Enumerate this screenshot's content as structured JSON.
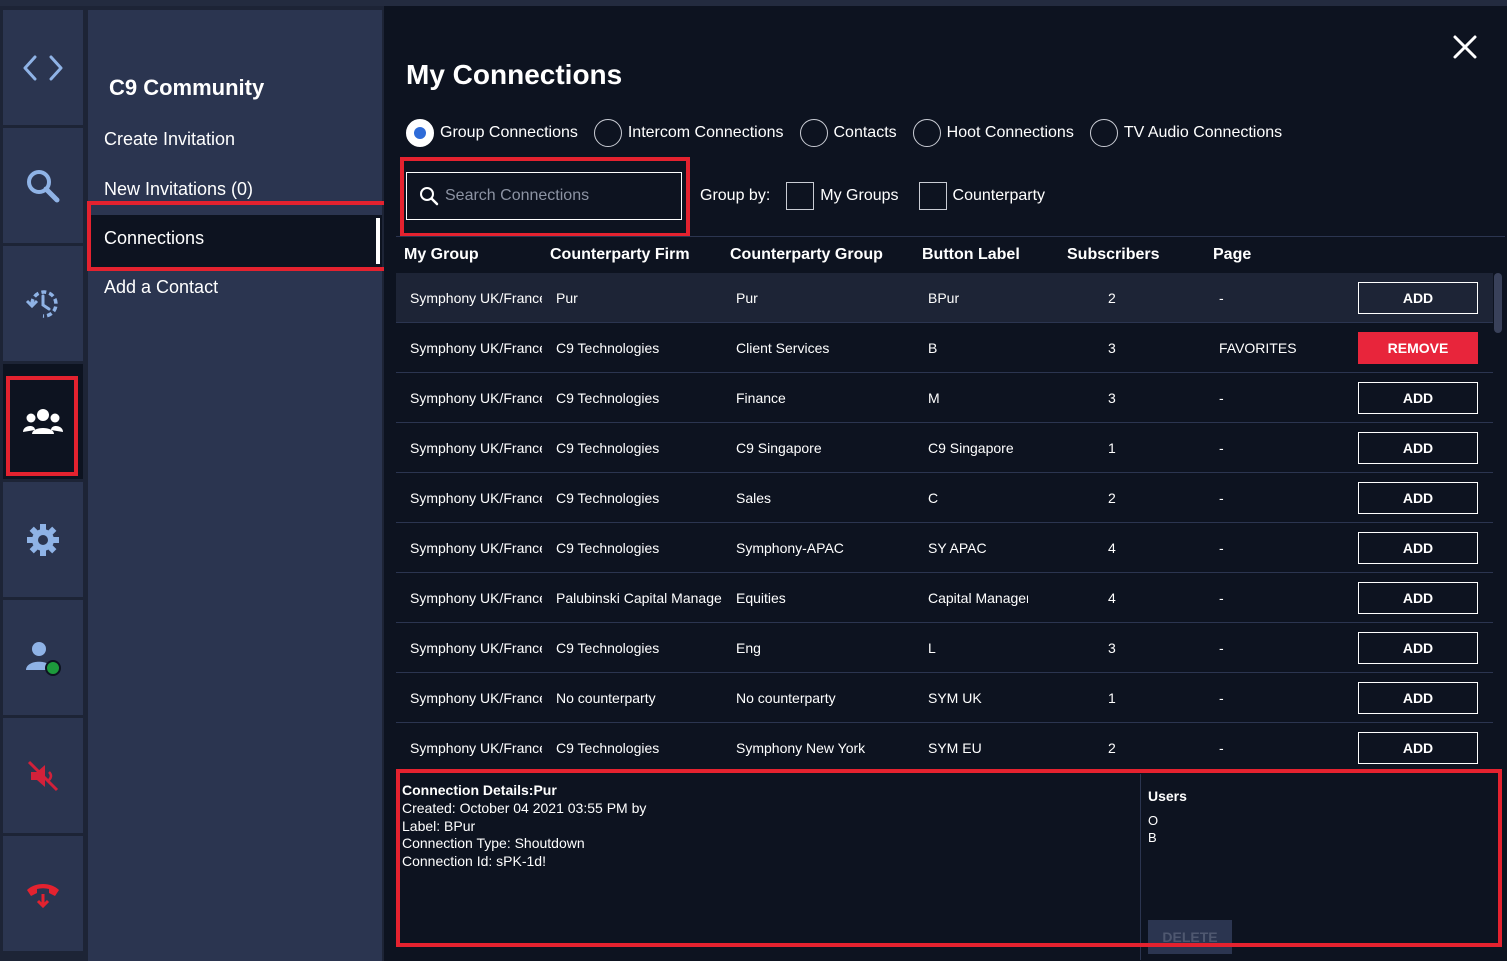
{
  "rail": {
    "items": [
      {
        "icon": "code-icon"
      },
      {
        "icon": "search-icon"
      },
      {
        "icon": "history-icon"
      },
      {
        "icon": "community-icon"
      },
      {
        "icon": "gear-icon"
      },
      {
        "icon": "user-status-icon"
      },
      {
        "icon": "speaker-muted-icon"
      },
      {
        "icon": "hangup-icon"
      }
    ]
  },
  "subnav": {
    "title": "C9 Community",
    "items": [
      "Create Invitation",
      "New Invitations (0)",
      "Connections",
      "Add a Contact"
    ],
    "selected": "Connections"
  },
  "main": {
    "title": "My Connections",
    "tabs": [
      "Group Connections",
      "Intercom Connections",
      "Contacts",
      "Hoot Connections",
      "TV Audio Connections"
    ],
    "selected_tab": "Group Connections",
    "search": {
      "placeholder": "Search Connections",
      "value": ""
    },
    "group_by": {
      "label": "Group by:",
      "options": [
        "My Groups",
        "Counterparty"
      ]
    }
  },
  "table": {
    "headers": [
      "My Group",
      "Counterparty Firm",
      "Counterparty Group",
      "Button Label",
      "Subscribers",
      "Page"
    ],
    "rows": [
      {
        "my_group": "Symphony UK/France",
        "firm": "Pur",
        "group": "Pur",
        "label": "BPur",
        "subs": "2",
        "page": "-",
        "action": "ADD"
      },
      {
        "my_group": "Symphony UK/France",
        "firm": "C9 Technologies",
        "group": "Client Services",
        "label": "B",
        "subs": "3",
        "page": "FAVORITES",
        "action": "REMOVE"
      },
      {
        "my_group": "Symphony UK/France",
        "firm": "C9 Technologies",
        "group": "Finance",
        "label": "M",
        "subs": "3",
        "page": "-",
        "action": "ADD"
      },
      {
        "my_group": "Symphony UK/France",
        "firm": "C9 Technologies",
        "group": "C9 Singapore",
        "label": "C9 Singapore",
        "subs": "1",
        "page": "-",
        "action": "ADD"
      },
      {
        "my_group": "Symphony UK/France",
        "firm": "C9 Technologies",
        "group": "Sales",
        "label": "C",
        "subs": "2",
        "page": "-",
        "action": "ADD"
      },
      {
        "my_group": "Symphony UK/France",
        "firm": "C9 Technologies",
        "group": "Symphony-APAC",
        "label": "SY APAC",
        "subs": "4",
        "page": "-",
        "action": "ADD"
      },
      {
        "my_group": "Symphony UK/France",
        "firm": "Palubinski Capital Management",
        "group": "Equities",
        "label": "Capital Manager",
        "subs": "4",
        "page": "-",
        "action": "ADD"
      },
      {
        "my_group": "Symphony UK/France",
        "firm": "C9 Technologies",
        "group": "Eng",
        "label": "L",
        "subs": "3",
        "page": "-",
        "action": "ADD"
      },
      {
        "my_group": "Symphony UK/France",
        "firm": "No counterparty",
        "group": "No counterparty",
        "label": "SYM UK",
        "subs": "1",
        "page": "-",
        "action": "ADD"
      },
      {
        "my_group": "Symphony UK/France",
        "firm": "C9 Technologies",
        "group": "Symphony New York",
        "label": "SYM EU",
        "subs": "2",
        "page": "-",
        "action": "ADD"
      }
    ]
  },
  "details": {
    "title": "Connection Details:Pur",
    "created": "Created: October 04 2021 03:55 PM by",
    "label": "Label: BPur",
    "type": "Connection Type: Shoutdown",
    "id": "Connection Id: sPK-1d!",
    "users_title": "Users",
    "users": [
      "O",
      "B"
    ],
    "delete_label": "DELETE"
  },
  "colors": {
    "accent_red": "#e4222f",
    "remove_red": "#e8253b",
    "radio_blue": "#2e6bd8",
    "status_green": "#1d9b3c"
  }
}
